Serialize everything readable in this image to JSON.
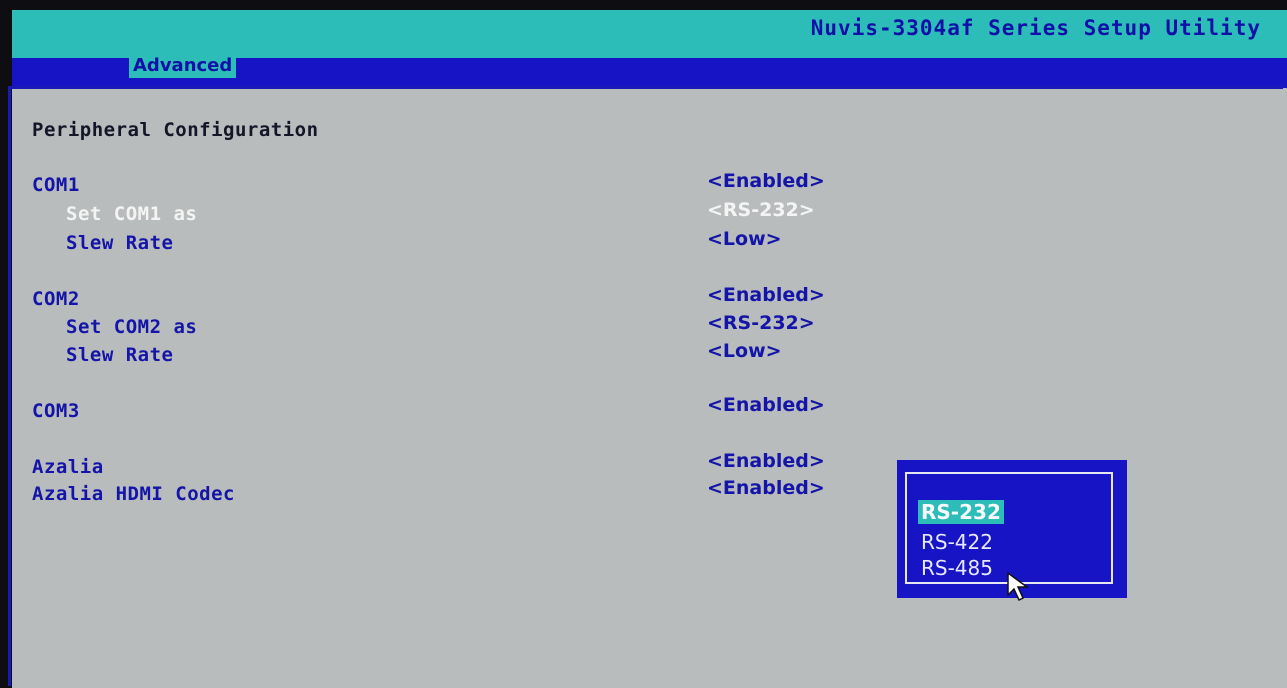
{
  "header": {
    "title": "Nuvis-3304af Series Setup Utility"
  },
  "tabs": [
    {
      "label": "Advanced",
      "active": true
    }
  ],
  "page": {
    "heading": "Peripheral Configuration",
    "items": [
      {
        "label": "COM1",
        "value": "<Enabled>"
      },
      {
        "label": "Set COM1 as",
        "value": "<RS-232>",
        "highlighted": true
      },
      {
        "label": "Slew Rate",
        "value": "<Low>"
      },
      {
        "label": "COM2",
        "value": "<Enabled>"
      },
      {
        "label": "Set COM2 as",
        "value": "<RS-232>"
      },
      {
        "label": "Slew Rate",
        "value": "<Low>"
      },
      {
        "label": "COM3",
        "value": "<Enabled>"
      },
      {
        "label": "Azalia",
        "value": "<Enabled>"
      },
      {
        "label": "Azalia HDMI Codec",
        "value": "<Enabled>"
      }
    ]
  },
  "popup": {
    "options": [
      "RS-232",
      "RS-422",
      "RS-485"
    ],
    "selected_index": 0
  },
  "colors": {
    "background": "#b9bcbc",
    "accent_blue": "#1614c4",
    "accent_cyan": "#2cbdb8",
    "text_blue": "#1414a8",
    "highlight_text": "#f4f4f4"
  },
  "icons": {
    "pointer": "mouse-pointer-icon"
  }
}
